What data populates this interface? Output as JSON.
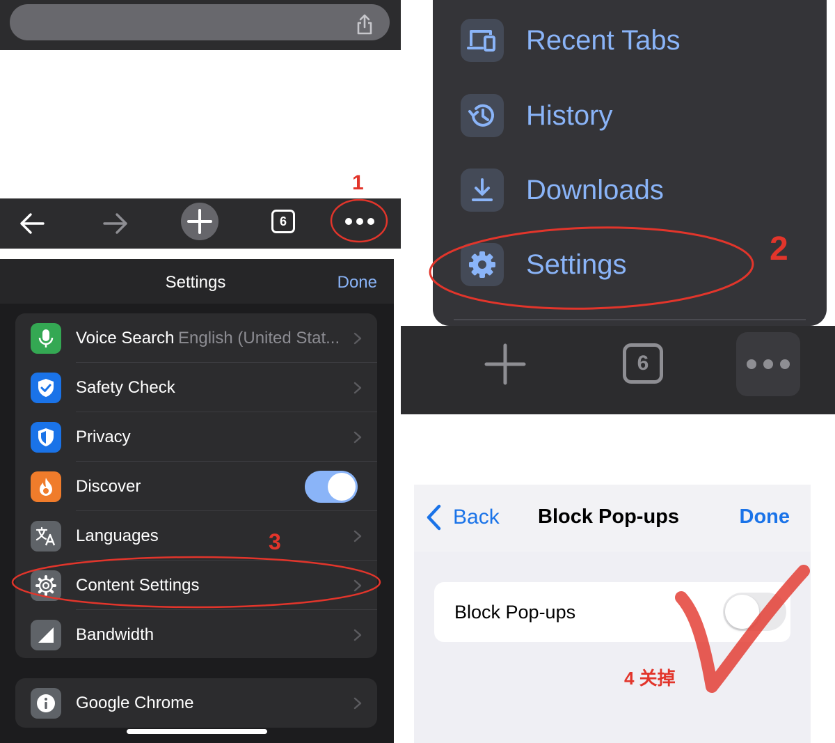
{
  "panel1": {
    "toolbar": {
      "back_icon": "arrow-left",
      "forward_icon": "arrow-right",
      "new_tab_icon": "plus-circle",
      "tab_count": "6",
      "more_icon": "ellipsis"
    },
    "step_label": "1"
  },
  "panel2": {
    "menu": [
      {
        "label": "Recent Tabs",
        "icon": "devices-icon"
      },
      {
        "label": "History",
        "icon": "history-icon"
      },
      {
        "label": "Downloads",
        "icon": "download-icon"
      },
      {
        "label": "Settings",
        "icon": "gear-icon"
      }
    ],
    "toolbar": {
      "tab_count": "6",
      "new_tab_icon": "plus",
      "more_icon": "ellipsis"
    },
    "step_label": "2"
  },
  "panel3": {
    "nav": {
      "title": "Settings",
      "done": "Done"
    },
    "items": [
      {
        "label": "Voice Search",
        "detail": "English (United Stat...",
        "icon": "microphone-icon",
        "color": "#34a853"
      },
      {
        "label": "Safety Check",
        "detail": "",
        "icon": "shield-check-icon",
        "color": "#1a73e8"
      },
      {
        "label": "Privacy",
        "detail": "",
        "icon": "shield-icon",
        "color": "#1a73e8"
      },
      {
        "label": "Discover",
        "detail": "",
        "icon": "flame-icon",
        "color": "#f07c2b",
        "toggle_on": true
      },
      {
        "label": "Languages",
        "detail": "",
        "icon": "translate-icon",
        "color": "#5f6368"
      },
      {
        "label": "Content Settings",
        "detail": "",
        "icon": "gear-icon",
        "color": "#5f6368"
      },
      {
        "label": "Bandwidth",
        "detail": "",
        "icon": "signal-icon",
        "color": "#5f6368"
      }
    ],
    "about": {
      "label": "Google Chrome",
      "icon": "info-icon"
    },
    "step_label": "3"
  },
  "panel4": {
    "nav": {
      "back": "Back",
      "title": "Block Pop-ups",
      "done": "Done"
    },
    "setting": {
      "label": "Block Pop-ups",
      "enabled": false
    },
    "step_label": "4 关掉"
  },
  "colors": {
    "accent_blue": "#8ab4f8",
    "ios_blue": "#1a73e8",
    "annotation_red": "#e2352b"
  }
}
